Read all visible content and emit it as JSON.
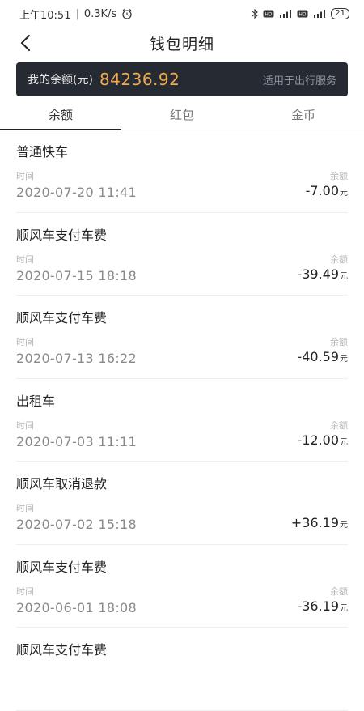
{
  "status_bar": {
    "time": "上午10:51",
    "speed": "0.3K/s",
    "battery": "21"
  },
  "nav": {
    "title": "钱包明细"
  },
  "balance": {
    "label": "我的余额(元)",
    "amount": "84236.92",
    "note": "适用于出行服务"
  },
  "tabs": [
    {
      "label": "余额",
      "active": true
    },
    {
      "label": "红包",
      "active": false
    },
    {
      "label": "金币",
      "active": false
    }
  ],
  "labels": {
    "time": "时间",
    "balance": "余额",
    "unit": "元"
  },
  "transactions": [
    {
      "title": "普通快车",
      "time": "2020-07-20 11:41",
      "amount": "-7.00"
    },
    {
      "title": "顺风车支付车费",
      "time": "2020-07-15 18:18",
      "amount": "-39.49"
    },
    {
      "title": "顺风车支付车费",
      "time": "2020-07-13 16:22",
      "amount": "-40.59"
    },
    {
      "title": "出租车",
      "time": "2020-07-03 11:11",
      "amount": "-12.00"
    },
    {
      "title": "顺风车取消退款",
      "time": "2020-07-02 15:18",
      "amount": "+36.19"
    },
    {
      "title": "顺风车支付车费",
      "time": "2020-06-01 18:08",
      "amount": "-36.19"
    },
    {
      "title": "顺风车支付车费",
      "time": "",
      "amount": ""
    }
  ]
}
